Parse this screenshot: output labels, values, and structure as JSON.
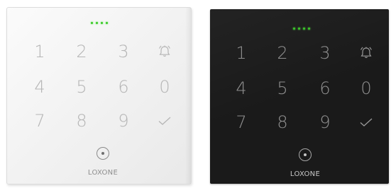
{
  "keypads": [
    {
      "finish": "white",
      "keys": [
        "1",
        "2",
        "3",
        "4",
        "5",
        "6",
        "0",
        "7",
        "8",
        "9"
      ],
      "icons": [
        "bell-icon",
        "checkmark-icon",
        "nfc-reader-icon",
        "led-indicator"
      ],
      "led_count": 4,
      "led_color": "#39c927",
      "brand": "LOXONE"
    },
    {
      "finish": "black",
      "keys": [
        "1",
        "2",
        "3",
        "4",
        "5",
        "6",
        "0",
        "7",
        "8",
        "9"
      ],
      "icons": [
        "bell-icon",
        "checkmark-icon",
        "nfc-reader-icon",
        "led-indicator"
      ],
      "led_count": 4,
      "led_color": "#39c927",
      "brand": "LOXONE"
    }
  ],
  "colors": {
    "panel_white": "#f4f4f4",
    "panel_black": "#1a1a1a",
    "digit_white": "#b5b5b5",
    "digit_black": "#8f8f8f"
  }
}
